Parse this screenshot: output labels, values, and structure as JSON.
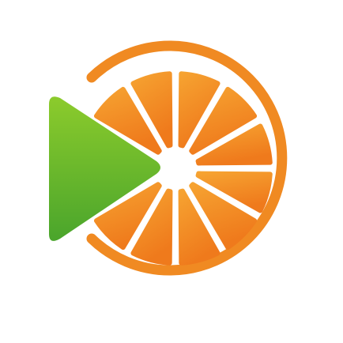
{
  "app_icon": {
    "icon": "orange-slice-play-icon",
    "colors": {
      "background": "#ffffff",
      "play_top": "#8ccb2c",
      "play_bottom": "#4aa52c",
      "orange_light": "#f6a331",
      "orange_dark": "#ef7a1c",
      "ring": "#f08a22"
    }
  }
}
